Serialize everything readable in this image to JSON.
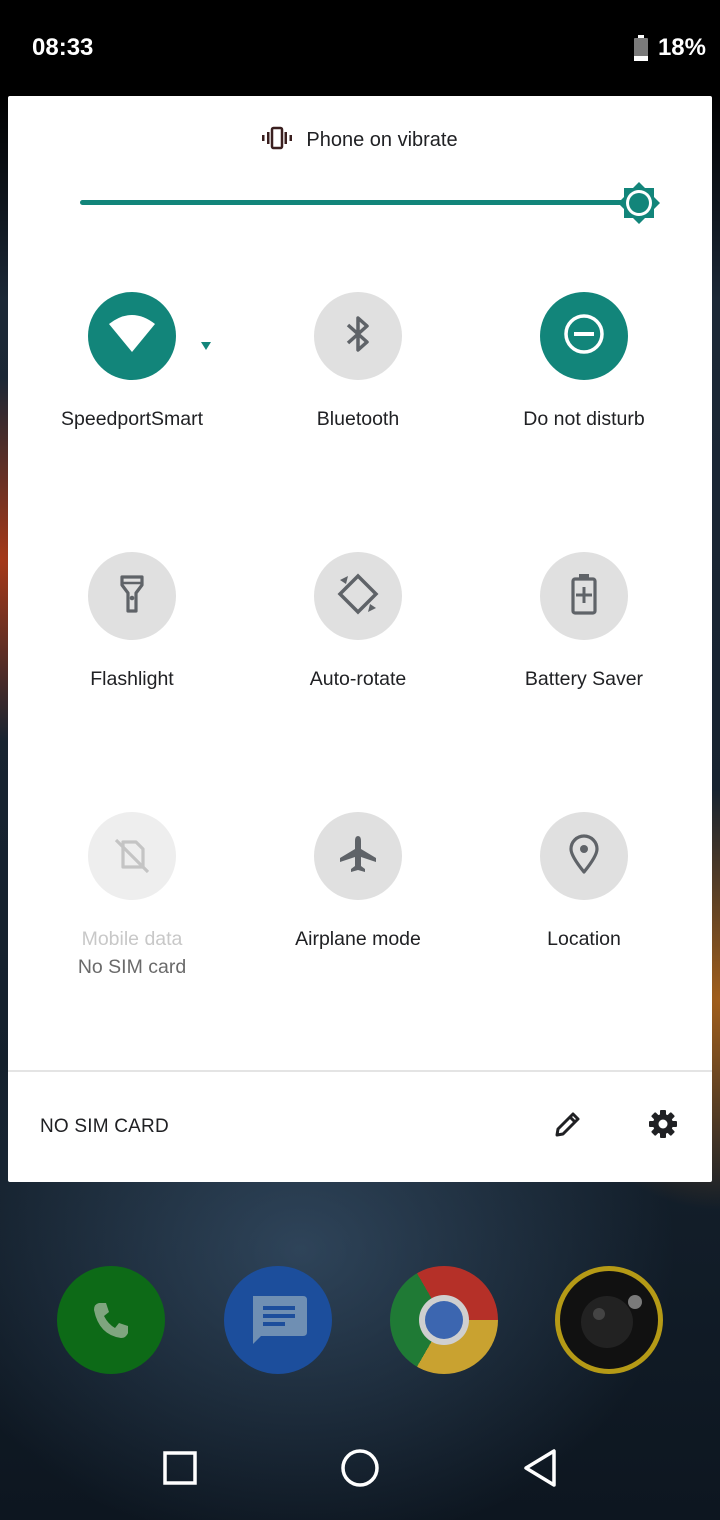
{
  "status_bar": {
    "time": "08:33",
    "battery_percent": "18%",
    "battery_level": 0.18
  },
  "quick_settings": {
    "ringer_text": "Phone on vibrate",
    "brightness_level": 1.0,
    "accent_color": "#12857a",
    "tiles": [
      {
        "label": "SpeedportSmart",
        "icon": "wifi-icon",
        "state": "on"
      },
      {
        "label": "Bluetooth",
        "icon": "bluetooth-icon",
        "state": "off"
      },
      {
        "label": "Do not disturb",
        "icon": "do-not-disturb-icon",
        "state": "on"
      },
      {
        "label": "Flashlight",
        "icon": "flashlight-icon",
        "state": "off"
      },
      {
        "label": "Auto-rotate",
        "icon": "auto-rotate-icon",
        "state": "off"
      },
      {
        "label": "Battery Saver",
        "icon": "battery-saver-icon",
        "state": "off"
      },
      {
        "label": "Mobile data",
        "sublabel": "No SIM card",
        "icon": "mobile-data-off-icon",
        "state": "disabled"
      },
      {
        "label": "Airplane mode",
        "icon": "airplane-icon",
        "state": "off"
      },
      {
        "label": "Location",
        "icon": "location-icon",
        "state": "off"
      }
    ],
    "footer": {
      "carrier_text": "NO SIM CARD",
      "edit_icon": "pencil-icon",
      "settings_icon": "gear-icon"
    }
  },
  "dock": [
    {
      "app": "phone-app-icon",
      "color": "#0f7a1d"
    },
    {
      "app": "messages-app-icon",
      "color": "#1f5fc7"
    },
    {
      "app": "chrome-app-icon",
      "color": "#d9342b"
    },
    {
      "app": "camera-app-icon",
      "color": "#111111"
    }
  ],
  "navigation": {
    "recents": "recents-button",
    "home": "home-button",
    "back": "back-button"
  }
}
